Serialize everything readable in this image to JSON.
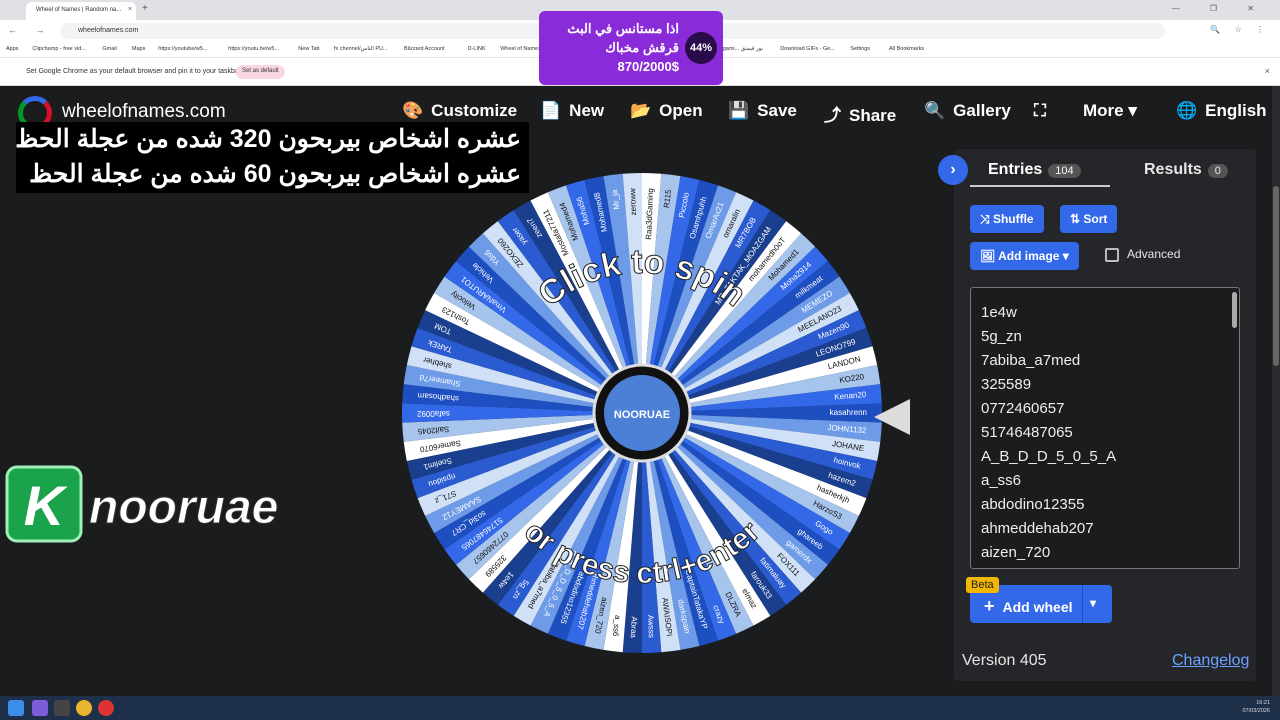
{
  "browser": {
    "tab_title": "Wheel of Names | Random na...",
    "tab_close": "×",
    "new_tab": "+",
    "window_controls": "— ❐ ✕",
    "nav_buttons": "← → ⟳",
    "url": "wheelofnames.com",
    "addr_icons": "🔍 ☆ ⋮",
    "bookmarks": [
      "Apps",
      "Clipchamp - free vid...",
      "Gmail",
      "Maps",
      "https://youtube/w5...",
      "https://youtu.be/w5...",
      "New Tab",
      "fx chennel/الناس PU...",
      "Blizzard Account",
      "D-LINK",
      "Wheel of Names | R...",
      "(5) Alert Box / Strea...",
      "Alert Box / Streamla...",
      "noor gami... نور قيمنق",
      "Download GIFs - Ge...",
      "Settings",
      "All Bookmarks"
    ],
    "infobar_text": "Set Google Chrome as your default browser and pin it to your taskbar",
    "infobar_button": "Set as default",
    "infobar_close": "×"
  },
  "app": {
    "logo_text": "wheelofnames.com",
    "menu": [
      {
        "icon": "🎨",
        "label": "Customize"
      },
      {
        "icon": "📄",
        "label": "New"
      },
      {
        "icon": "📂",
        "label": "Open"
      },
      {
        "icon": "💾",
        "label": "Save"
      },
      {
        "icon": "⤴",
        "label": "Share"
      },
      {
        "icon": "🔍",
        "label": "Gallery"
      },
      {
        "icon": "⛶",
        "label": ""
      },
      {
        "icon": "",
        "label": "More ▾"
      },
      {
        "icon": "🌐",
        "label": "English"
      }
    ]
  },
  "overlay": {
    "line1": "عشره اشخاص بيربحون 320 شده من عجلة الحظ",
    "line2": "عشره اشخاص بيربحون 60 شده من عجلة الحظ"
  },
  "knooruae_logo": {
    "k": "K",
    "text": "nooruae"
  },
  "wheel": {
    "top_text": "Click to spin",
    "bottom_text": "or press ctrl+enter",
    "center_logo": "NOORUAE",
    "colors": [
      "#ffffff",
      "#a7c4ec",
      "#3369e8",
      "#1e4fc0",
      "#6d9be8",
      "#cfe0f7",
      "#2a5bd0",
      "#1a3f8f"
    ],
    "segment_names": [
      "Raa3dGaming",
      "R115",
      "Piccolo",
      "Osamhpuhh",
      "OmarAx21",
      "omaralin",
      "MR7BOB",
      "MR_TAKTAK_MOAZGAM",
      "mohamedh0oT",
      "Mohamed1",
      "Moha2914",
      "milkmeat",
      "MEMEZO",
      "MEELANO23",
      "Mazen90",
      "LEONO799",
      "LANDON",
      "KO220",
      "Kenan20",
      "kasahrenn",
      "JOHN1132",
      "JOHANE",
      "hoinvok",
      "hazem2",
      "hasherkjh",
      "HarzoS3",
      "Gogo",
      "ghareeb",
      "gamerdx",
      "FOX111",
      "fatimaluay",
      "farouk33",
      "elmaz",
      "DLZRA",
      "crazy",
      "CaptainTatakaYP",
      "darkspain",
      "AWAISOPI",
      "Awsss",
      "Abraa",
      "a_ss6",
      "aizen_720",
      "ahmeddehab207",
      "abdodino12355",
      "A_B_D_D_5_0_5_A",
      "7abiba_a7med",
      "5g_zn",
      "1e4w",
      "325589",
      "0772460657",
      "51746487065",
      "so3id_CR7",
      "SAAMEY12",
      "S71_z",
      "ripsidou",
      "Soelim1",
      "Samer6070",
      "Saif2045",
      "safa0092",
      "shadhosam",
      "Shameer7d",
      "shebher",
      "TAREk",
      "TOM",
      "Tosh123",
      "Velocity",
      "VmaNARUTO1",
      "Vehicle",
      "Yds6",
      "ZEXO260",
      "yaser",
      "zeen7",
      "Mostafa77211",
      "Mohamed4",
      "Moha56",
      "Mohamed8",
      "Mr_ja",
      "zeroww"
    ]
  },
  "panel": {
    "toggle": "›",
    "entries_tab": "Entries",
    "entries_count": "104",
    "results_tab": "Results",
    "results_count": "0",
    "shuffle": "Shuffle",
    "sort": "Sort",
    "add_image": "Add image",
    "advanced": "Advanced",
    "entries": [
      "1e4w",
      "5g_zn",
      "7abiba_a7med",
      "325589",
      "0772460657",
      "51746487065",
      "A_B_D_D_5_0_5_A",
      "a_ss6",
      "abdodino12355",
      "ahmeddehab207",
      "aizen_720"
    ],
    "beta": "Beta",
    "add_wheel": "Add wheel",
    "version": "Version 405",
    "changelog": "Changelog"
  },
  "promo": {
    "line1": "اذا مستانس في البث",
    "line2": "قرقش مخباك",
    "line3": "870/2000$",
    "percent": "44%"
  },
  "taskbar": {
    "time": "16:21",
    "date": "07/03/2026"
  }
}
